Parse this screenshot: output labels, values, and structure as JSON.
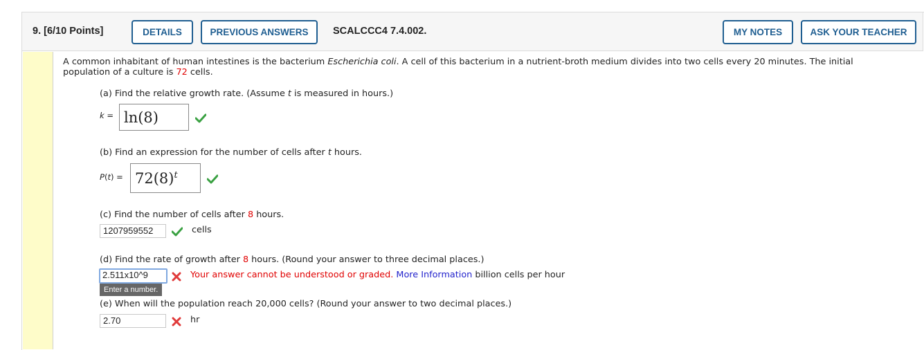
{
  "header": {
    "question_label": "9.  [6/10 Points]",
    "details_button": "DETAILS",
    "previous_answers_button": "PREVIOUS ANSWERS",
    "problem_code": "SCALCCC4 7.4.002.",
    "my_notes_button": "MY NOTES",
    "ask_teacher_button": "ASK YOUR TEACHER"
  },
  "problem": {
    "intro_line1_a": "A common inhabitant of human intestines is the bacterium ",
    "intro_line1_italic": "Escherichia coli",
    "intro_line1_b": ". A cell of this bacterium in a nutrient-broth medium divides into two cells every 20 minutes. The initial",
    "intro_line2_a": "population of a culture is ",
    "intro_initial_value": "72",
    "intro_line2_b": " cells."
  },
  "parts": {
    "a": {
      "prompt_a": "(a) Find the relative growth rate. (Assume ",
      "prompt_var": "t",
      "prompt_b": " is measured in hours.)",
      "label": "k =",
      "answer": "ln(8)",
      "status": "correct"
    },
    "b": {
      "prompt_a": "(b) Find an expression for the number of cells after ",
      "prompt_var": "t",
      "prompt_b": " hours.",
      "label": "P(t) =",
      "answer_base": "72(8)",
      "answer_exp": "t",
      "status": "correct"
    },
    "c": {
      "prompt_a": "(c) Find the number of cells after ",
      "prompt_value": "8",
      "prompt_b": " hours.",
      "answer": "1207959552",
      "unit": "cells",
      "status": "correct"
    },
    "d": {
      "prompt_a": "(d) Find the rate of growth after ",
      "prompt_value": "8",
      "prompt_b": " hours. (Round your answer to three decimal places.)",
      "answer": "2.511x10^9",
      "status": "incorrect",
      "error_message": "Your answer cannot be understood or graded.",
      "more_info_link": "More Information",
      "unit": "billion cells per hour",
      "tooltip": "Enter a number."
    },
    "e": {
      "prompt": "(e) When will the population reach 20,000 cells? (Round your answer to two decimal places.)",
      "answer": "2.70",
      "unit": "hr",
      "status": "incorrect"
    }
  },
  "colors": {
    "accent_blue": "#1f5e91",
    "highlight_red": "#e00000",
    "link_blue": "#2222cc",
    "correct_green": "#3aa142",
    "sidebar_yellow": "#fefcc9"
  }
}
